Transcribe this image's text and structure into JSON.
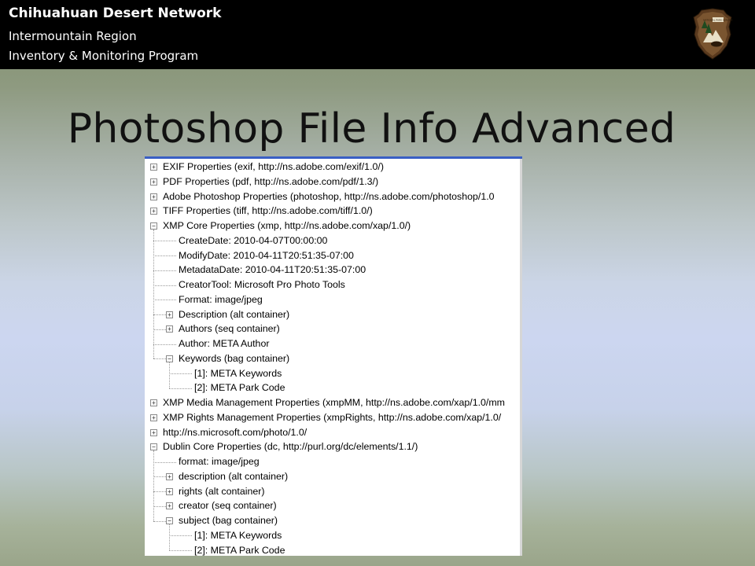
{
  "header": {
    "line1": "Chihuahuan Desert Network",
    "line2": "Intermountain Region",
    "line3": "Inventory & Monitoring Program",
    "logo_text": "NATIONAL PARK SERVICE"
  },
  "slide_title": "Photoshop File Info Advanced",
  "tree": [
    {
      "label": "EXIF Properties (exif, http://ns.adobe.com/exif/1.0/)",
      "level": 0,
      "expander": "+"
    },
    {
      "label": "PDF Properties (pdf, http://ns.adobe.com/pdf/1.3/)",
      "level": 0,
      "expander": "+"
    },
    {
      "label": "Adobe Photoshop Properties (photoshop, http://ns.adobe.com/photoshop/1.0",
      "level": 0,
      "expander": "+"
    },
    {
      "label": "TIFF Properties (tiff, http://ns.adobe.com/tiff/1.0/)",
      "level": 0,
      "expander": "+"
    },
    {
      "label": "XMP Core Properties (xmp, http://ns.adobe.com/xap/1.0/)",
      "level": 0,
      "expander": "-"
    },
    {
      "label": "CreateDate: 2010-04-07T00:00:00",
      "level": 1,
      "expander": ""
    },
    {
      "label": "ModifyDate: 2010-04-11T20:51:35-07:00",
      "level": 1,
      "expander": ""
    },
    {
      "label": "MetadataDate: 2010-04-11T20:51:35-07:00",
      "level": 1,
      "expander": ""
    },
    {
      "label": "CreatorTool: Microsoft Pro Photo Tools",
      "level": 1,
      "expander": ""
    },
    {
      "label": "Format: image/jpeg",
      "level": 1,
      "expander": ""
    },
    {
      "label": "Description (alt container)",
      "level": 1,
      "expander": "+"
    },
    {
      "label": "Authors (seq container)",
      "level": 1,
      "expander": "+"
    },
    {
      "label": "Author: META Author",
      "level": 1,
      "expander": ""
    },
    {
      "label": "Keywords (bag container)",
      "level": 1,
      "expander": "-"
    },
    {
      "label": "[1]: META Keywords",
      "level": 2,
      "expander": ""
    },
    {
      "label": "[2]: META Park Code",
      "level": 2,
      "expander": ""
    },
    {
      "label": "XMP Media Management Properties (xmpMM, http://ns.adobe.com/xap/1.0/mm",
      "level": 0,
      "expander": "+"
    },
    {
      "label": "XMP Rights Management Properties (xmpRights, http://ns.adobe.com/xap/1.0/",
      "level": 0,
      "expander": "+"
    },
    {
      "label": "http://ns.microsoft.com/photo/1.0/",
      "level": 0,
      "expander": "+"
    },
    {
      "label": "Dublin Core Properties (dc, http://purl.org/dc/elements/1.1/)",
      "level": 0,
      "expander": "-"
    },
    {
      "label": "format: image/jpeg",
      "level": 1,
      "expander": ""
    },
    {
      "label": "description (alt container)",
      "level": 1,
      "expander": "+"
    },
    {
      "label": "rights (alt container)",
      "level": 1,
      "expander": "+"
    },
    {
      "label": "creator (seq container)",
      "level": 1,
      "expander": "+"
    },
    {
      "label": "subject (bag container)",
      "level": 1,
      "expander": "-"
    },
    {
      "label": "[1]: META Keywords",
      "level": 2,
      "expander": ""
    },
    {
      "label": "[2]: META Park Code",
      "level": 2,
      "expander": ""
    }
  ]
}
